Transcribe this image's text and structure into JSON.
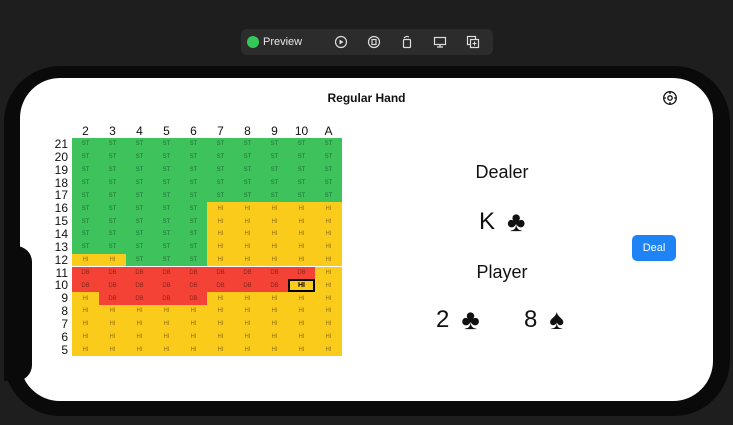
{
  "toolbar": {
    "preview_label": "Preview",
    "icons": [
      "play-icon",
      "stop-icon",
      "rotate-icon",
      "device-icon",
      "duplicate-icon"
    ]
  },
  "nav": {
    "title": "Regular Hand",
    "settings_icon": "gear-icon"
  },
  "chart": {
    "columns": [
      "2",
      "3",
      "4",
      "5",
      "6",
      "7",
      "8",
      "9",
      "10",
      "A"
    ],
    "rows": [
      "21",
      "20",
      "19",
      "18",
      "17",
      "16",
      "15",
      "14",
      "13",
      "12",
      "11",
      "10",
      "9",
      "8",
      "7",
      "6",
      "5"
    ],
    "codes": {
      "S": {
        "text": "ST",
        "color": "#3ec25c"
      },
      "H": {
        "text": "HI",
        "color": "#fbcb1c"
      },
      "D": {
        "text": "DB",
        "color": "#f44236"
      }
    },
    "grid": [
      "SSSSSSSSSS",
      "SSSSSSSSSS",
      "SSSSSSSSSS",
      "SSSSSSSSSS",
      "SSSSSSSSSS",
      "SSSSSHHHHH",
      "SSSSSHHHHH",
      "SSSSSHHHHH",
      "SSSSSHHHHH",
      "HHSSSHHHHH",
      "DDDDDDDDDH",
      "DDDDDDDDHH",
      "HDDDDHHHHH",
      "HHHHHHHHHH",
      "HHHHHHHHHH",
      "HHHHHHHHHH",
      "HHHHHHHHHH"
    ],
    "selected": {
      "row": "10",
      "col": "10"
    }
  },
  "dealer": {
    "label": "Dealer",
    "card": {
      "rank": "K",
      "suit": "♣"
    }
  },
  "player": {
    "label": "Player",
    "cards": [
      {
        "rank": "2",
        "suit": "♣"
      },
      {
        "rank": "8",
        "suit": "♠"
      }
    ]
  },
  "deal_button": {
    "label": "Deal"
  }
}
